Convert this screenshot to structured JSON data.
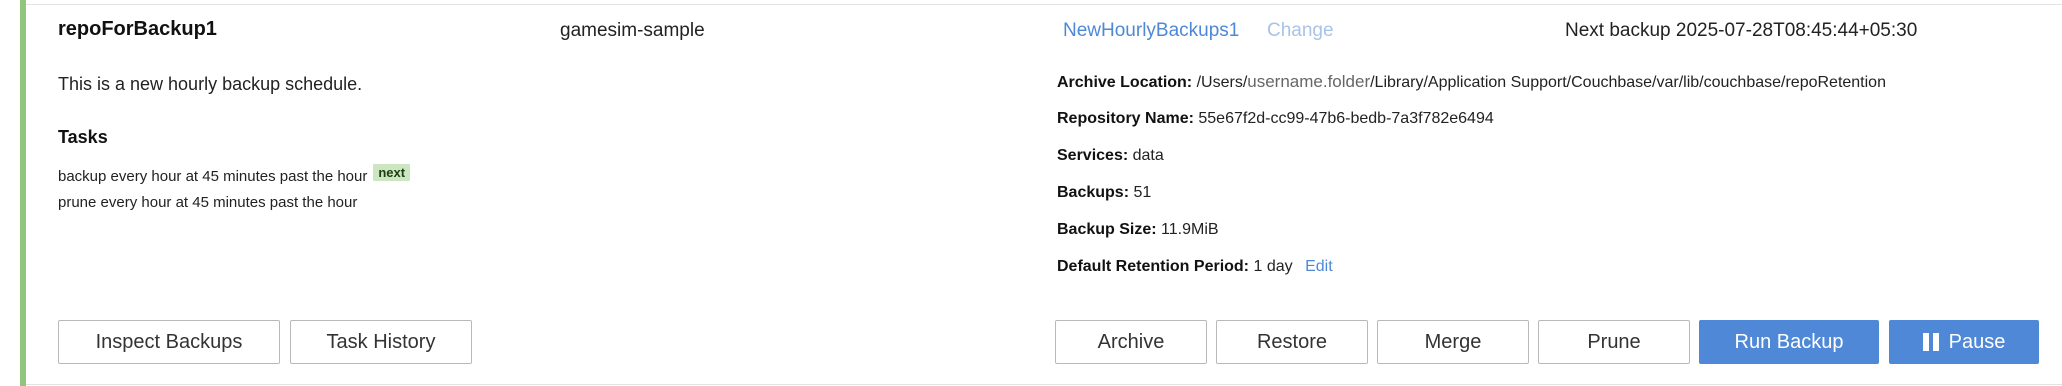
{
  "repo": {
    "name": "repoForBackup1",
    "cluster": "gamesim-sample",
    "plan_name": "NewHourlyBackups1",
    "change_label": "Change",
    "next_backup": "Next backup 2025-07-28T08:45:44+05:30",
    "description": "This is a new hourly backup schedule."
  },
  "tasks": {
    "title": "Tasks",
    "items": [
      {
        "text": "backup every hour at 45 minutes past the hour",
        "badge": "next"
      },
      {
        "text": "prune every hour at 45 minutes past the hour"
      }
    ]
  },
  "details": {
    "archive_location_label": "Archive Location:",
    "archive_location_prefix": "/Users/",
    "archive_location_user": "username.folder",
    "archive_location_suffix": "/Library/Application Support/Couchbase/var/lib/couchbase/repoRetention",
    "repository_name_label": "Repository Name:",
    "repository_name": "55e67f2d-cc99-47b6-bedb-7a3f782e6494",
    "services_label": "Services:",
    "services": "data",
    "backups_label": "Backups:",
    "backups": "51",
    "backup_size_label": "Backup Size:",
    "backup_size": "11.9MiB",
    "retention_label": "Default Retention Period:",
    "retention": "1 day",
    "edit_label": "Edit"
  },
  "buttons": {
    "inspect_backups": "Inspect Backups",
    "task_history": "Task History",
    "archive": "Archive",
    "restore": "Restore",
    "merge": "Merge",
    "prune": "Prune",
    "run_backup": "Run Backup",
    "pause": "Pause"
  },
  "colors": {
    "accent_bar": "#92c47d",
    "primary": "#4e88d6",
    "badge_bg": "#cde6c2"
  }
}
